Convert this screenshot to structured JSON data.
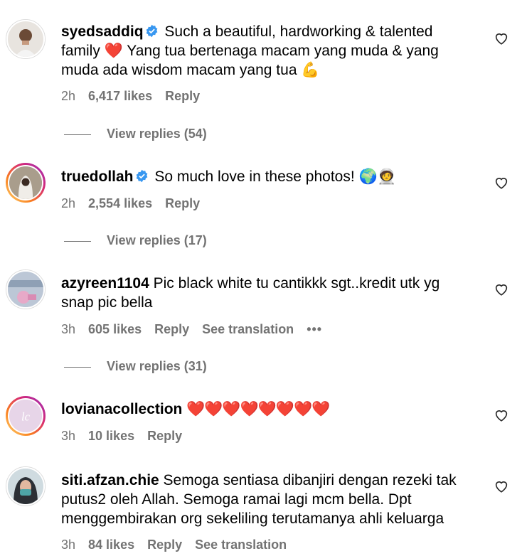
{
  "comments": [
    {
      "username": "syedsaddiq",
      "verified": true,
      "text_before": " Such a beautiful, hardworking & talented family ",
      "emoji_mid": "❤️",
      "text_after": " Yang tua bertenaga macam yang muda & yang muda ada wisdom macam yang tua ",
      "emoji_end": "💪",
      "time": "2h",
      "likes": "6,417 likes",
      "reply": "Reply",
      "view_replies": "View replies (54)"
    },
    {
      "username": "truedollah",
      "verified": true,
      "text": " So much love in these photos! ",
      "emoji_end": "🌍🧑‍🚀",
      "time": "2h",
      "likes": "2,554 likes",
      "reply": "Reply",
      "view_replies": "View replies (17)"
    },
    {
      "username": "azyreen1104",
      "text": " Pic black white tu cantikkk sgt..kredit utk yg snap pic bella",
      "time": "3h",
      "likes": "605 likes",
      "reply": "Reply",
      "see_translation": "See translation",
      "more": "•••",
      "view_replies": "View replies (31)"
    },
    {
      "username": "lovianacollection",
      "emoji_text": " ❤️❤️❤️❤️❤️❤️❤️❤️",
      "time": "3h",
      "likes": "10 likes",
      "reply": "Reply"
    },
    {
      "username": "siti.afzan.chie",
      "text": " Semoga sentiasa dibanjiri dengan rezeki tak putus2 oleh Allah. Semoga ramai lagi mcm bella. Dpt menggembirakan org sekeliling terutamanya ahli keluarga",
      "time": "3h",
      "likes": "84 likes",
      "reply": "Reply",
      "see_translation": "See translation"
    }
  ],
  "colors": {
    "verified": "#3897f0",
    "meta": "#737373",
    "heart_red": "#e0242c"
  },
  "icons": {
    "like": "heart-outline-icon",
    "verified": "verified-badge-icon"
  }
}
